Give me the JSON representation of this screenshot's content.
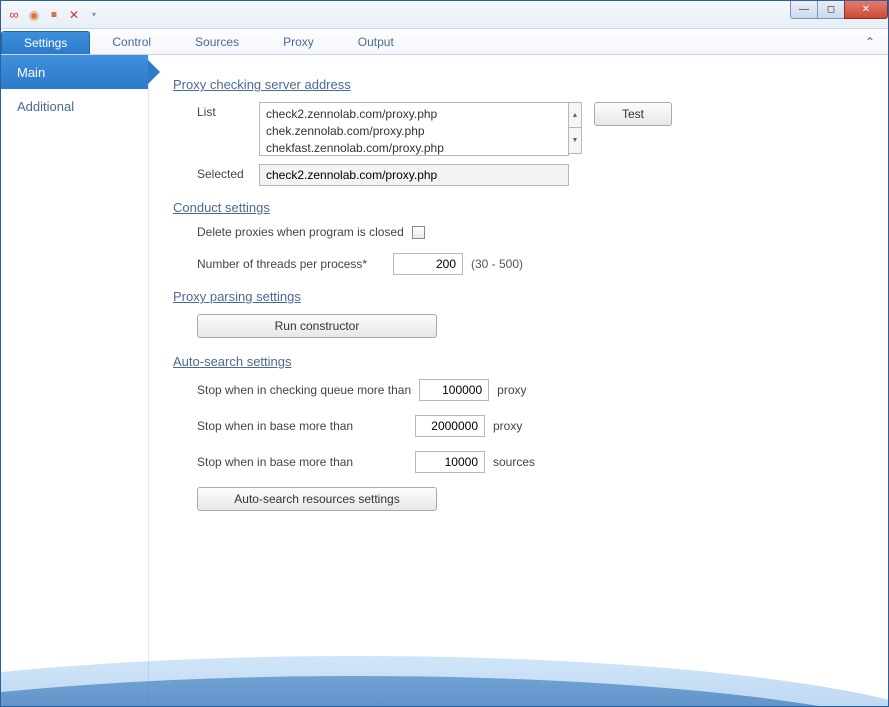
{
  "ribbon": {
    "tabs": [
      "Settings",
      "Control",
      "Sources",
      "Proxy",
      "Output"
    ],
    "active": 0
  },
  "sidebar": {
    "items": [
      "Main",
      "Additional"
    ],
    "active": 0
  },
  "sections": {
    "proxy_server": {
      "title": "Proxy checking server address",
      "list_label": "List",
      "list_value": "check2.zennolab.com/proxy.php\nchek.zennolab.com/proxy.php\nchekfast.zennolab.com/proxy.php",
      "selected_label": "Selected",
      "selected_value": "check2.zennolab.com/proxy.php",
      "test_btn": "Test"
    },
    "conduct": {
      "title": "Conduct settings",
      "delete_label": "Delete proxies when program is closed",
      "threads_label": "Number of threads per process*",
      "threads_value": "200",
      "threads_hint": "(30 - 500)"
    },
    "parsing": {
      "title": "Proxy parsing settings",
      "run_btn": "Run constructor"
    },
    "autosearch": {
      "title": "Auto-search settings",
      "row1_label": "Stop when in checking queue more than",
      "row1_value": "100000",
      "row1_unit": "proxy",
      "row2_label": "Stop when in base more than",
      "row2_value": "2000000",
      "row2_unit": "proxy",
      "row3_label": "Stop when in base more than",
      "row3_value": "10000",
      "row3_unit": "sources",
      "settings_btn": "Auto-search resources settings"
    }
  }
}
